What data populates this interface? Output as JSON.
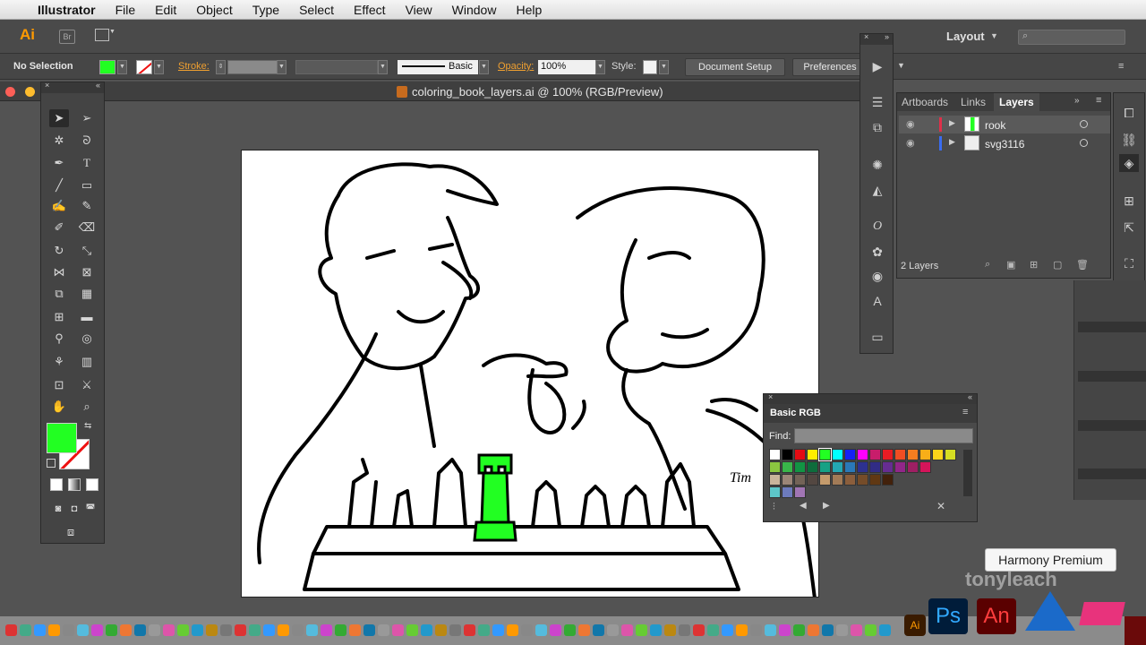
{
  "menubar": {
    "app_name": "Illustrator",
    "items": [
      "File",
      "Edit",
      "Object",
      "Type",
      "Select",
      "Effect",
      "View",
      "Window",
      "Help"
    ]
  },
  "appbar": {
    "logo": "Ai",
    "bridge": "Br",
    "layout_label": "Layout"
  },
  "control": {
    "selection_label": "No Selection",
    "fill_color": "#22ff22",
    "stroke_label": "Stroke:",
    "brush_label": "Basic",
    "opacity_label": "Opacity:",
    "opacity_value": "100%",
    "style_label": "Style:",
    "document_setup": "Document Setup",
    "preferences": "Preferences"
  },
  "document": {
    "title": "coloring_book_layers.ai @ 100% (RGB/Preview)"
  },
  "layers_panel": {
    "tabs": [
      "Artboards",
      "Links",
      "Layers"
    ],
    "active_tab": "Layers",
    "layers": [
      {
        "name": "rook",
        "color": "#e0304a",
        "selected": true
      },
      {
        "name": "svg3116",
        "color": "#3a6cf0",
        "selected": false
      }
    ],
    "count": "2 Layers"
  },
  "swatches_panel": {
    "title": "Basic RGB",
    "find_label": "Find:",
    "row1": [
      "#ffffff",
      "#000000",
      "#e30b13",
      "#ffed00",
      "#22ff22",
      "#00ffff",
      "#1521f5",
      "#ff00ff",
      "#c81d6b",
      "#e81c24",
      "#f04e23",
      "#f47d20",
      "#f8ae18",
      "#fdd51a",
      "#d6de23"
    ],
    "row2": [
      "#8bc640",
      "#39b54a",
      "#129444",
      "#0e6c3c",
      "#17a185",
      "#24a8b3",
      "#2a79b8",
      "#2d3190",
      "#312c86",
      "#662d91",
      "#912689",
      "#9e1f63",
      "#d4145a"
    ],
    "row3": [
      "#c9b49b",
      "#9b8678",
      "#736357",
      "#534741",
      "#c59b6c",
      "#a27b57",
      "#8b5e3c",
      "#754c29",
      "#603813",
      "#42210b"
    ],
    "row4": [
      "#5dc6c9",
      "#6d7bbd",
      "#a175b4"
    ]
  },
  "tooltip": "Harmony Premium",
  "watermark": "tonyleach",
  "dock": {
    "ai": "Ai",
    "ps": "Ps",
    "an": "An"
  }
}
